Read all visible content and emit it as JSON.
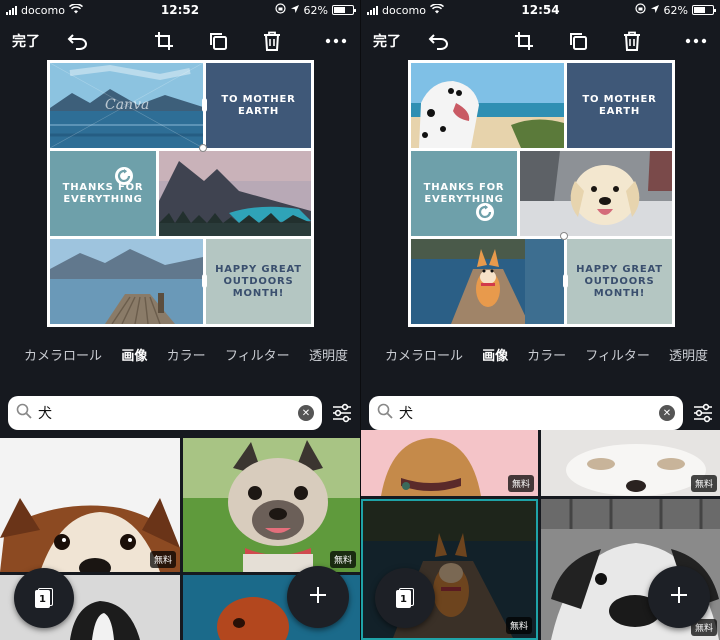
{
  "status": {
    "left": {
      "carrier": "docomo",
      "time": "12:52",
      "battery": "62%"
    },
    "right": {
      "carrier": "docomo",
      "time": "12:54",
      "battery": "62%"
    }
  },
  "toolbar": {
    "done_label": "完了"
  },
  "design": {
    "to_mother_earth": "TO MOTHER\nEARTH",
    "thanks": "THANKS FOR\nEVERYTHING",
    "outdoors": "HAPPY GREAT\nOUTDOORS\nMONTH!",
    "watermark": "Canva"
  },
  "tabs": [
    "カメラロール",
    "画像",
    "カラー",
    "フィルター",
    "透明度"
  ],
  "active_tab": "画像",
  "search": {
    "query": "犬"
  },
  "badge_free": "無料",
  "pages": {
    "current": "1"
  },
  "colors": {
    "bg": "#16191f",
    "navy_tile": "#3f5878",
    "teal_tile": "#6ea0aa",
    "sage_tile": "#b4c6c2",
    "sage_text": "#3a4f6e"
  }
}
